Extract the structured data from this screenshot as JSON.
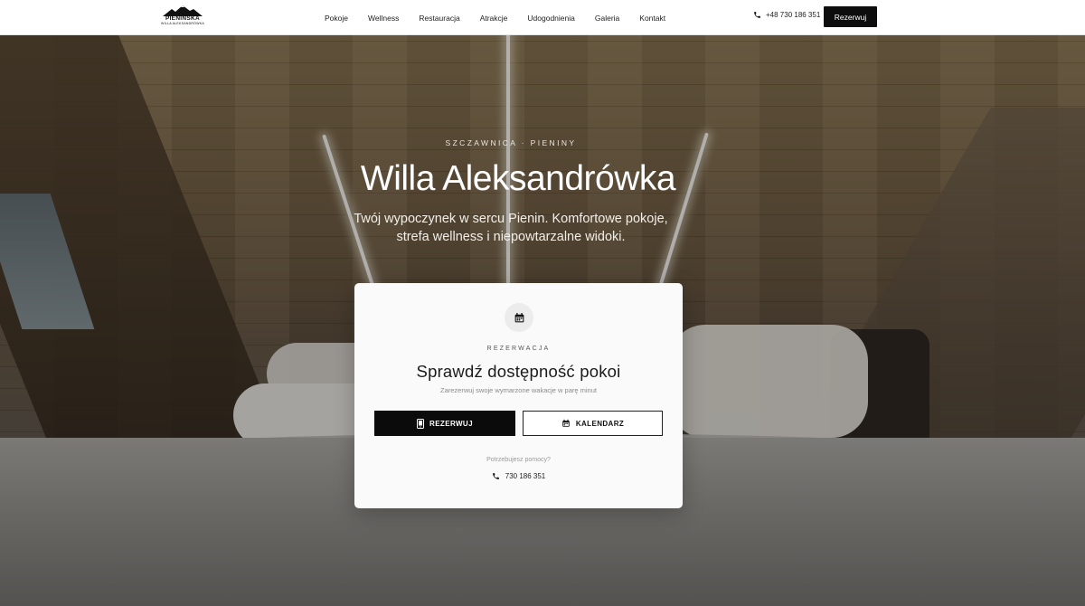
{
  "header": {
    "logo_line1": "PIENIŃSKA",
    "logo_line2": "WILLA ALEKSANDRÓWKA",
    "nav": [
      "Pokoje",
      "Wellness",
      "Restauracja",
      "Atrakcje",
      "Udogodnienia",
      "Galeria",
      "Kontakt"
    ],
    "phone": "+48 730 186 351",
    "cta": "Rezerwuj"
  },
  "hero": {
    "eyebrow": "SZCZAWNICA · PIENINY",
    "title": "Willa Aleksandrówka",
    "subtitle_line1": "Twój wypoczynek w sercu Pienin. Komfortowe pokoje,",
    "subtitle_line2": "strefa wellness i niepowtarzalne widoki."
  },
  "booking": {
    "label": "REZERWACJA",
    "heading": "Sprawdź dostępność pokoi",
    "description": "Zarezerwuj swoje wymarzone wakacje w parę minut",
    "primary_button": "REZERWUJ",
    "secondary_button": "KALENDARZ",
    "help_text": "Potrzebujesz pomocy?",
    "phone": "730 186 351"
  },
  "colors": {
    "accent": "#0b0b0b",
    "header_bg": "#ffffff",
    "card_bg": "#fafafa"
  },
  "icons": [
    "mountain-logo-icon",
    "phone-icon",
    "calendar-icon",
    "mobile-phone-icon"
  ]
}
